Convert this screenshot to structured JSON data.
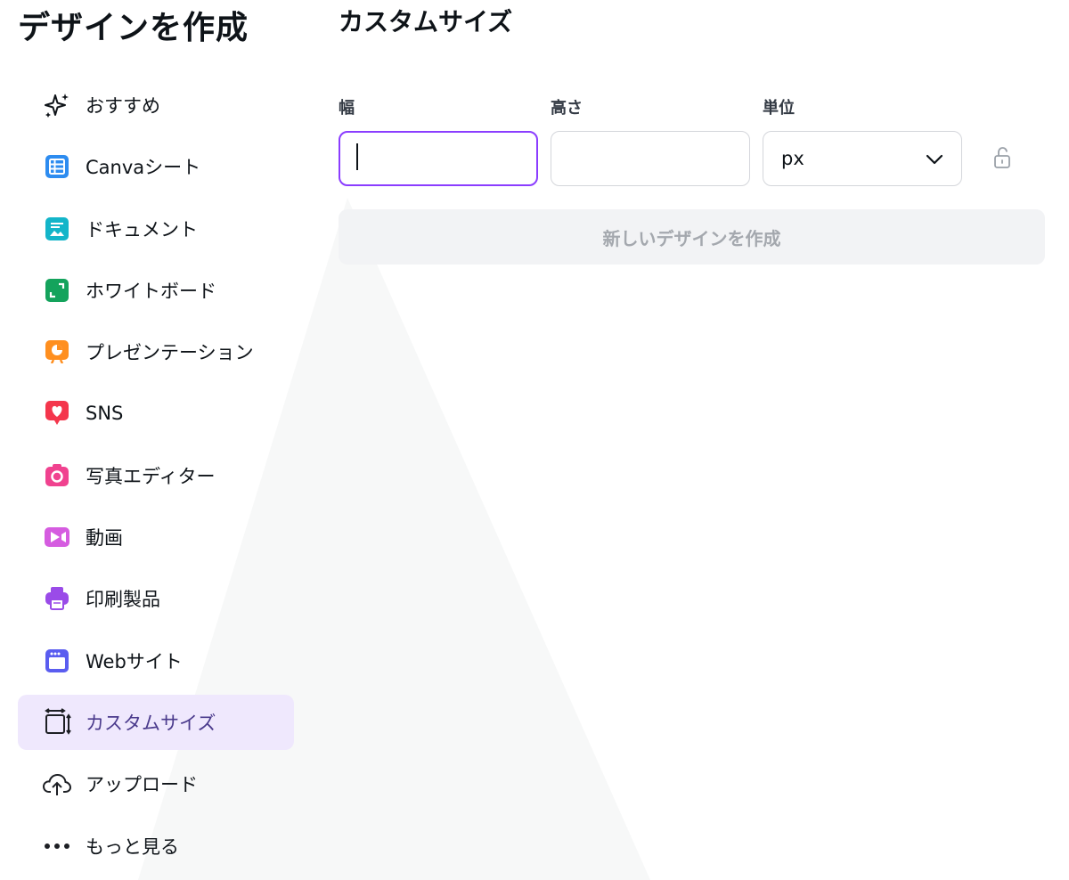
{
  "page_title": "デザインを作成",
  "sidebar": {
    "items": [
      {
        "label": "おすすめ",
        "icon": "sparkle-icon"
      },
      {
        "label": "Canvaシート",
        "icon": "sheet-icon"
      },
      {
        "label": "ドキュメント",
        "icon": "document-icon"
      },
      {
        "label": "ホワイトボード",
        "icon": "whiteboard-icon"
      },
      {
        "label": "プレゼンテーション",
        "icon": "presentation-icon"
      },
      {
        "label": "SNS",
        "icon": "heart-icon"
      },
      {
        "label": "写真エディター",
        "icon": "camera-icon"
      },
      {
        "label": "動画",
        "icon": "video-icon"
      },
      {
        "label": "印刷製品",
        "icon": "printer-icon"
      },
      {
        "label": "Webサイト",
        "icon": "website-icon"
      },
      {
        "label": "カスタムサイズ",
        "icon": "custom-size-icon",
        "active": true
      },
      {
        "label": "アップロード",
        "icon": "cloud-upload-icon"
      },
      {
        "label": "もっと見る",
        "icon": "more-dots-icon"
      }
    ]
  },
  "custom_size": {
    "title": "カスタムサイズ",
    "width_label": "幅",
    "height_label": "高さ",
    "unit_label": "単位",
    "width_value": "",
    "height_value": "",
    "unit_value": "px",
    "create_button": "新しいデザインを作成"
  },
  "colors": {
    "accent": "#8b3dff",
    "active_bg": "#efe8fd",
    "sheet": "#2d8cf0",
    "document": "#13b5c9",
    "whiteboard": "#14a35c",
    "presentation": "#ff8f1f",
    "sns": "#f4364c",
    "photo": "#f0428f",
    "video": "#d55ce0",
    "print": "#9a4be8",
    "website": "#5a5df0"
  }
}
